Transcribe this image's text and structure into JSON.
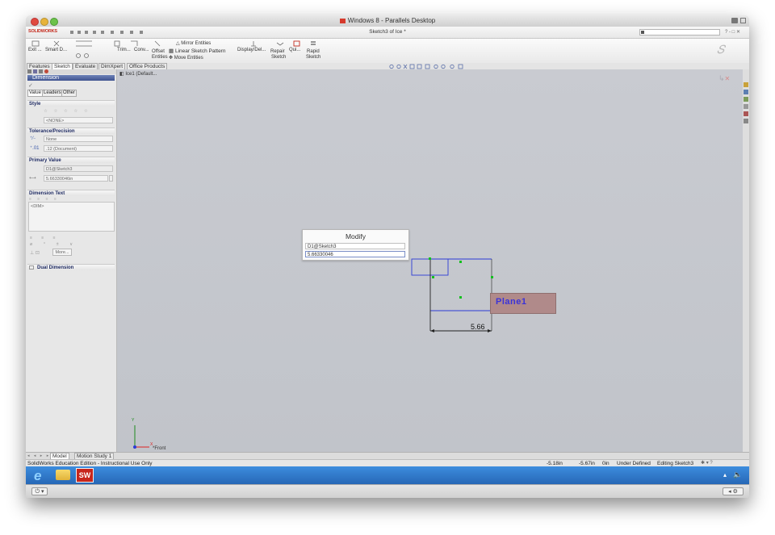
{
  "mac": {
    "window_title": "Windows 8 - Parallels Desktop"
  },
  "sw": {
    "logo": "SOLIDWORKS",
    "doc_title": "Sketch3 of Ice *"
  },
  "toolbar": {
    "items": [
      {
        "name": "exit-sketch",
        "label": "Exit ..."
      },
      {
        "name": "smart-dimension",
        "label": "Smart D..."
      },
      {
        "name": "trim-entities",
        "label": "Trim..."
      },
      {
        "name": "convert-entities",
        "label": "Conv..."
      },
      {
        "name": "offset-entities",
        "label": "Offset"
      },
      {
        "name": "display-delete-relations",
        "label": "Display/Del..."
      },
      {
        "name": "repair-sketch",
        "label": "Repair"
      },
      {
        "name": "quick-snaps",
        "label": "Qui..."
      },
      {
        "name": "rapid-sketch",
        "label": "Rapid"
      }
    ],
    "sublabels": {
      "entities": "Entities",
      "sketch1": "Sketch",
      "sketch2": "Sketch"
    },
    "mirror": "Mirror Entities",
    "linear_pattern": "Linear Sketch Pattern",
    "move": "Move Entities"
  },
  "tabs": [
    "Features",
    "Sketch",
    "Evaluate",
    "DimXpert",
    "Office Products"
  ],
  "panel": {
    "title": "Dimension",
    "subtabs": [
      "Value",
      "Leaders",
      "Other"
    ],
    "style_header": "Style",
    "style_value": "<NONE>",
    "tolerance_header": "Tolerance/Precision",
    "tolerance_type": "None",
    "precision": ".12 (Document)",
    "primary_header": "Primary Value",
    "primary_name": "D1@Sketch3",
    "primary_value": "5.66330046in",
    "text_header": "Dimension Text",
    "text_value": "<DIM>",
    "more_button": "More...",
    "dual_header": "Dual Dimension"
  },
  "canvas": {
    "tree_label": "Ice1 (Default...",
    "plane_label": "Plane1",
    "dimension_value": "5.66",
    "view_name": "*Front"
  },
  "modify_dialog": {
    "title": "Modify",
    "name": "D1@Sketch3",
    "value": "5.66330046"
  },
  "bottom_tabs": [
    "Model",
    "Motion Study 1"
  ],
  "status": {
    "left": "SolidWorks Education Edition - Instructional Use Only",
    "x": "-5.18in",
    "y": "-5.67in",
    "z": "0in",
    "state": "Under Defined",
    "editing": "Editing Sketch3"
  },
  "colors": {
    "plane_label_bg": "#b08a8a",
    "plane_text": "#3b33d8",
    "taskbar": "#2f76c9",
    "sketch_blue": "#2c3bd6",
    "endpoint_green": "#13c01f"
  }
}
